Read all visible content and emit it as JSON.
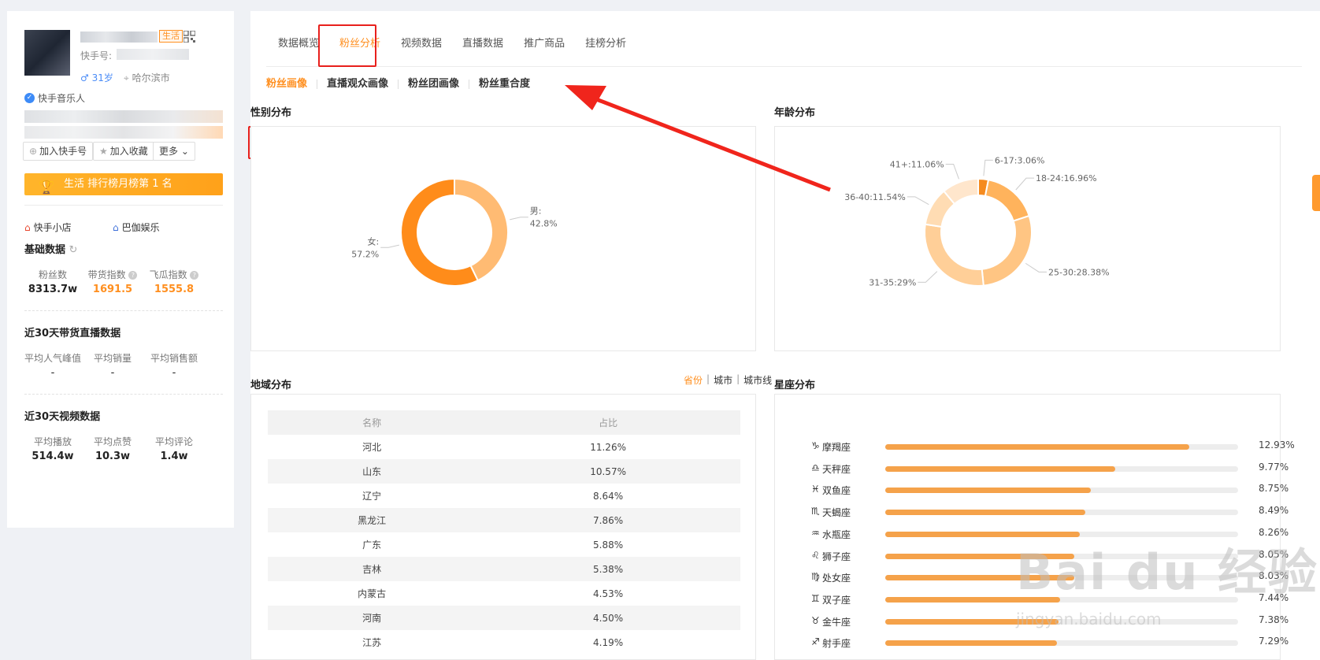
{
  "profile": {
    "tag": "生活",
    "ks_id_label": "快手号:",
    "gender_age": "♂ 31岁",
    "location": "哈尔滨市",
    "verified": "快手音乐人",
    "actions": [
      "加入快手号",
      "加入收藏",
      "更多"
    ],
    "rank": "生活 排行榜月榜第 1 名",
    "shop": "快手小店",
    "org": "巴伽娱乐",
    "basic_title": "基础数据",
    "basic": [
      {
        "label": "粉丝数",
        "value": "8313.7w"
      },
      {
        "label": "带货指数",
        "value": "1691.5"
      },
      {
        "label": "飞瓜指数",
        "value": "1555.8"
      }
    ],
    "live_title": "近30天带货直播数据",
    "live": [
      {
        "label": "平均人气峰值",
        "value": "-"
      },
      {
        "label": "平均销量",
        "value": "-"
      },
      {
        "label": "平均销售额",
        "value": "-"
      }
    ],
    "video_title": "近30天视频数据",
    "video": [
      {
        "label": "平均播放",
        "value": "514.4w"
      },
      {
        "label": "平均点赞",
        "value": "10.3w"
      },
      {
        "label": "平均评论",
        "value": "1.4w"
      }
    ]
  },
  "tabs": [
    "数据概览",
    "粉丝分析",
    "视频数据",
    "直播数据",
    "推广商品",
    "挂榜分析"
  ],
  "subtabs": [
    "粉丝画像",
    "直播观众画像",
    "粉丝团画像",
    "粉丝重合度"
  ],
  "panels": {
    "gender": "性别分布",
    "age": "年龄分布",
    "region": "地域分布",
    "zodiac": "星座分布"
  },
  "region_switch": [
    "省份",
    "城市",
    "城市线"
  ],
  "colors": {
    "accent": "#ff8f1f",
    "highlight": "#e8201c"
  },
  "chart_data": [
    {
      "type": "pie",
      "title": "性别分布",
      "labels": [
        "男",
        "女"
      ],
      "values": [
        42.8,
        57.2
      ],
      "value_labels": [
        "42.8%",
        "57.2%"
      ]
    },
    {
      "type": "pie",
      "title": "年龄分布",
      "labels": [
        "6-17",
        "18-24",
        "25-30",
        "31-35",
        "36-40",
        "41+"
      ],
      "values": [
        3.06,
        16.96,
        28.38,
        29,
        11.54,
        11.06
      ],
      "value_labels": [
        "6-17:3.06%",
        "18-24:16.96%",
        "25-30:28.38%",
        "31-35:29%",
        "36-40:11.54%",
        "41+:11.06%"
      ]
    },
    {
      "type": "table",
      "title": "地域分布",
      "columns": [
        "名称",
        "占比"
      ],
      "rows": [
        [
          "河北",
          "11.26%"
        ],
        [
          "山东",
          "10.57%"
        ],
        [
          "辽宁",
          "8.64%"
        ],
        [
          "黑龙江",
          "7.86%"
        ],
        [
          "广东",
          "5.88%"
        ],
        [
          "吉林",
          "5.38%"
        ],
        [
          "内蒙古",
          "4.53%"
        ],
        [
          "河南",
          "4.50%"
        ],
        [
          "江苏",
          "4.19%"
        ]
      ]
    },
    {
      "type": "bar",
      "title": "星座分布",
      "categories": [
        "摩羯座",
        "天秤座",
        "双鱼座",
        "天蝎座",
        "水瓶座",
        "狮子座",
        "处女座",
        "双子座",
        "金牛座",
        "射手座"
      ],
      "icons": [
        "♑",
        "♎",
        "♓",
        "♏",
        "♒",
        "♌",
        "♍",
        "♊",
        "♉",
        "♐"
      ],
      "values": [
        12.93,
        9.77,
        8.75,
        8.49,
        8.26,
        8.05,
        8.03,
        7.44,
        7.38,
        7.29
      ],
      "value_labels": [
        "12.93%",
        "9.77%",
        "8.75%",
        "8.49%",
        "8.26%",
        "8.05%",
        "8.03%",
        "7.44%",
        "7.38%",
        "7.29%"
      ],
      "xlim": [
        0,
        15
      ]
    }
  ]
}
